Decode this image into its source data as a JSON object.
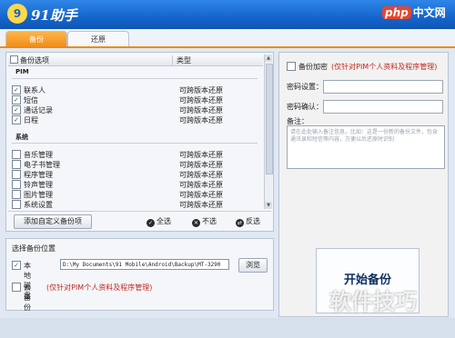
{
  "app": {
    "title": "91助手",
    "logo_glyph": "9",
    "watermark_top": "中文网",
    "watermark_badge": "php",
    "watermark_bottom": "软件技巧"
  },
  "tabs": [
    {
      "label": "备份"
    },
    {
      "label": "还原"
    }
  ],
  "list": {
    "header_col1": "备份选项",
    "header_col2": "类型",
    "group_pim": "PIM",
    "group_system": "系统",
    "pim_items": [
      {
        "label": "联系人",
        "type": "可跨版本还原",
        "checked": true
      },
      {
        "label": "短信",
        "type": "可跨版本还原",
        "checked": true
      },
      {
        "label": "通话记录",
        "type": "可跨版本还原",
        "checked": true
      },
      {
        "label": "日程",
        "type": "可跨版本还原",
        "checked": true
      }
    ],
    "system_items": [
      {
        "label": "音乐管理",
        "type": "可跨版本还原",
        "checked": false
      },
      {
        "label": "电子书管理",
        "type": "可跨版本还原",
        "checked": false
      },
      {
        "label": "程序管理",
        "type": "可跨版本还原",
        "checked": false
      },
      {
        "label": "铃声管理",
        "type": "可跨版本还原",
        "checked": false
      },
      {
        "label": "图片管理",
        "type": "可跨版本还原",
        "checked": false
      },
      {
        "label": "系统设置",
        "type": "可跨版本还原",
        "checked": false
      }
    ],
    "check_mark": "✓",
    "add_button": "添加自定义备份项",
    "select_all": "全选",
    "select_none": "不选",
    "invert": "反选"
  },
  "location": {
    "title": "选择备份位置",
    "local_label": "本地磁盘",
    "path_value": "D:\\My Documents\\91 Mobile\\Android\\Backup\\MT-3290",
    "browse": "浏览",
    "cloud_label": "云备份",
    "cloud_note": "(仅针对PIM个人资料及程序管理)"
  },
  "encrypt": {
    "label": "备份加密",
    "note": "(仅针对PIM个人资料及程序管理)",
    "pw_label": "密码设置：",
    "pw_confirm_label": "密码确认：",
    "remark_label": "备注：",
    "remark_text": "请在此处输入备注信息，比如：这是一份新的备份文件，包含通讯录和短信等内容，方便以后还原时识别"
  },
  "start_button": "开始备份",
  "colors": {
    "accent": "#f08a12",
    "title_bar": "#1565cc",
    "note_red": "#c0271f"
  }
}
